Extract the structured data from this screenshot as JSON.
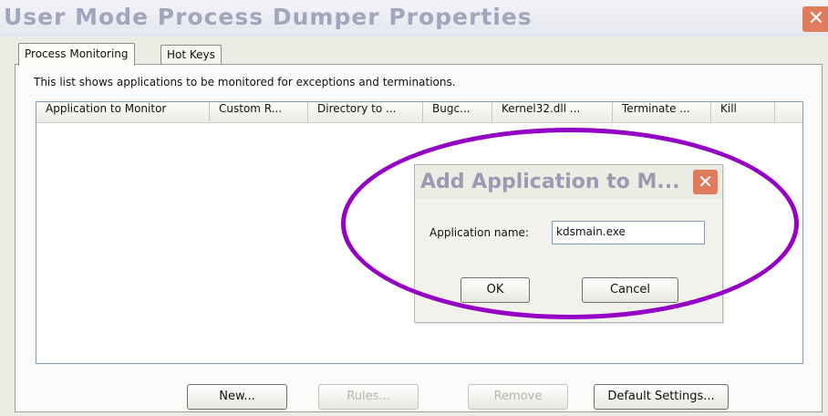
{
  "window": {
    "title": "User Mode Process Dumper Properties",
    "close_symbol": "✕"
  },
  "tabs": [
    {
      "label": "Process Monitoring",
      "active": true
    },
    {
      "label": "Hot Keys",
      "active": false
    }
  ],
  "panel": {
    "description": "This list shows applications to be monitored for exceptions and terminations."
  },
  "list": {
    "columns": [
      "Application to Monitor",
      "Custom R...",
      "Directory to ...",
      "Bugc...",
      "Kernel32.dll ...",
      "Terminate ...",
      "Kill"
    ],
    "rows": []
  },
  "buttons": {
    "new": "New...",
    "rules": "Rules...",
    "remove": "Remove",
    "default_settings": "Default Settings..."
  },
  "dialog": {
    "title": "Add Application to M...",
    "close_symbol": "✕",
    "label": "Application name:",
    "value": "kdsmain.exe",
    "ok": "OK",
    "cancel": "Cancel"
  },
  "colors": {
    "highlight_oval": "#9400c4",
    "close_button": "#e07b5c",
    "title_text": "#a3a5bc"
  }
}
